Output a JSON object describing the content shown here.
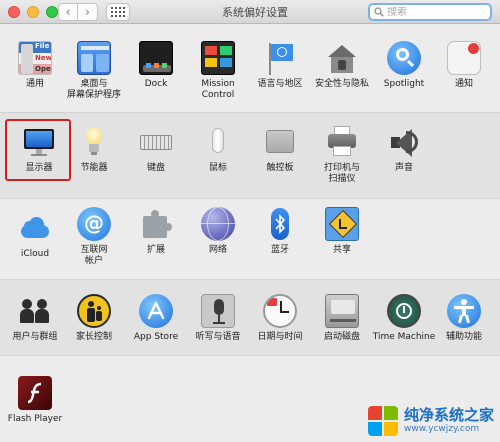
{
  "window": {
    "title": "系统偏好设置",
    "search_placeholder": "搜索",
    "nav_back": "‹",
    "nav_forward": "›"
  },
  "rows": [
    [
      {
        "id": "general",
        "label": "通用",
        "icon": "general-icon"
      },
      {
        "id": "desktop",
        "label": "桌面与\n屏幕保护程序",
        "icon": "desktop-icon"
      },
      {
        "id": "dock",
        "label": "Dock",
        "icon": "dock-icon"
      },
      {
        "id": "mission",
        "label": "Mission\nControl",
        "icon": "mission-control-icon"
      },
      {
        "id": "language",
        "label": "语言与地区",
        "icon": "flag-icon"
      },
      {
        "id": "security",
        "label": "安全性与隐私",
        "icon": "house-lock-icon"
      },
      {
        "id": "spotlight",
        "label": "Spotlight",
        "icon": "magnifier-icon"
      },
      {
        "id": "notifications",
        "label": "通知",
        "icon": "notifications-icon"
      }
    ],
    [
      {
        "id": "displays",
        "label": "显示器",
        "icon": "monitor-icon"
      },
      {
        "id": "energy",
        "label": "节能器",
        "icon": "lightbulb-icon"
      },
      {
        "id": "keyboard",
        "label": "键盘",
        "icon": "keyboard-icon"
      },
      {
        "id": "mouse",
        "label": "鼠标",
        "icon": "mouse-icon"
      },
      {
        "id": "trackpad",
        "label": "触控板",
        "icon": "trackpad-icon"
      },
      {
        "id": "printers",
        "label": "打印机与\n扫描仪",
        "icon": "printer-icon"
      },
      {
        "id": "sound",
        "label": "声音",
        "icon": "speaker-icon"
      }
    ],
    [
      {
        "id": "icloud",
        "label": "iCloud",
        "icon": "cloud-icon"
      },
      {
        "id": "internet",
        "label": "互联网\n帐户",
        "icon": "at-icon"
      },
      {
        "id": "extensions",
        "label": "扩展",
        "icon": "puzzle-icon"
      },
      {
        "id": "network",
        "label": "网络",
        "icon": "globe-icon"
      },
      {
        "id": "bluetooth",
        "label": "蓝牙",
        "icon": "bluetooth-icon"
      },
      {
        "id": "sharing",
        "label": "共享",
        "icon": "sharing-icon"
      }
    ],
    [
      {
        "id": "users",
        "label": "用户与群组",
        "icon": "users-icon"
      },
      {
        "id": "parental",
        "label": "家长控制",
        "icon": "parental-icon"
      },
      {
        "id": "appstore",
        "label": "App Store",
        "icon": "app-store-icon"
      },
      {
        "id": "dictation",
        "label": "听写与语音",
        "icon": "microphone-icon"
      },
      {
        "id": "datetime",
        "label": "日期与时间",
        "icon": "clock-icon"
      },
      {
        "id": "startup",
        "label": "启动磁盘",
        "icon": "disk-icon"
      },
      {
        "id": "timemachine",
        "label": "Time Machine",
        "icon": "time-machine-icon"
      },
      {
        "id": "accessibility",
        "label": "辅助功能",
        "icon": "accessibility-icon"
      }
    ],
    [
      {
        "id": "flash",
        "label": "Flash Player",
        "icon": "flash-icon"
      }
    ]
  ],
  "general_icon_text": [
    "File",
    "New",
    "Ope"
  ],
  "watermark": {
    "main": "纯净系统之家",
    "sub": "www.ycwjzy.com"
  },
  "colors": {
    "highlight": "#d62020",
    "accent_blue": "#1b6fc8"
  }
}
